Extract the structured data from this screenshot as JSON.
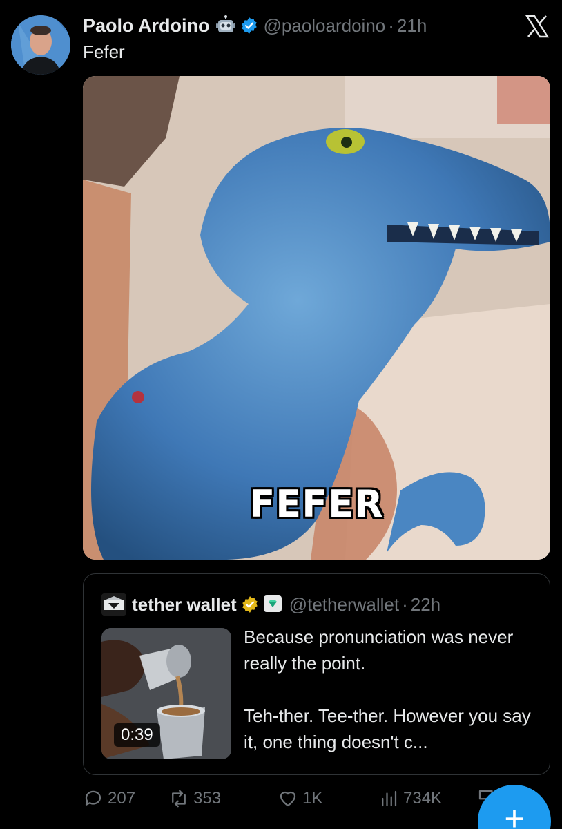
{
  "tweet": {
    "display_name": "Paolo Ardoino",
    "handle": "@paoloardoino",
    "separator": "·",
    "time": "21h",
    "text": "Fefer",
    "media_caption": "FEFER",
    "icons": {
      "name_emoji": "robot-icon",
      "verified": "verified-badge-icon",
      "platform": "x-logo-icon"
    }
  },
  "quote": {
    "display_name": "tether wallet",
    "handle": "@tetherwallet",
    "separator": "·",
    "time": "22h",
    "video_duration": "0:39",
    "text_line1": "Because pronunciation was never really the point.",
    "text_line2": "Teh-ther. Tee-ther. However you say it, one thing doesn't c..."
  },
  "actions": {
    "replies": "207",
    "reposts": "353",
    "likes": "1K",
    "views": "734K"
  },
  "fab": {
    "label": "+"
  },
  "colors": {
    "accent": "#1d9bf0",
    "muted": "#71767b",
    "text": "#e7e9ea",
    "background": "#000000",
    "gold": "#e2b719"
  }
}
